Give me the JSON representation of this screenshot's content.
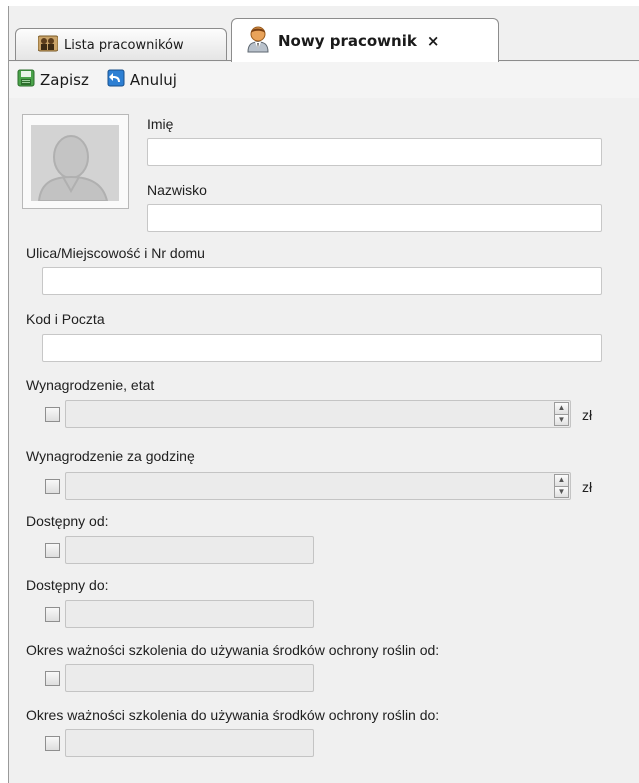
{
  "tabs": {
    "inactive_label": "Lista pracowników",
    "active_label": "Nowy pracownik",
    "close_glyph": "×"
  },
  "toolbar": {
    "save_label": "Zapisz",
    "cancel_label": "Anuluj"
  },
  "form": {
    "first_name_label": "Imię",
    "first_name_value": "",
    "last_name_label": "Nazwisko",
    "last_name_value": "",
    "street_label": "Ulica/Miejscowość i Nr domu",
    "street_value": "",
    "postal_label": "Kod i Poczta",
    "postal_value": "",
    "salary_label": "Wynagrodzenie, etat",
    "salary_value": "",
    "salary_unit": "zł",
    "hourly_label": "Wynagrodzenie za godzinę",
    "hourly_value": "",
    "hourly_unit": "zł",
    "available_from_label": "Dostępny od:",
    "available_from_value": "",
    "available_to_label": "Dostępny do:",
    "available_to_value": "",
    "training_from_label": "Okres ważności szkolenia do używania środków ochrony roślin od:",
    "training_from_value": "",
    "training_to_label": "Okres ważności szkolenia do używania środków ochrony roślin do:",
    "training_to_value": ""
  },
  "icons": {
    "employees_tab": "employees-group-icon",
    "new_employee_tab": "person-icon",
    "save": "save-disk-icon",
    "cancel": "undo-arrow-icon",
    "photo": "avatar-placeholder-icon"
  },
  "colors": {
    "save_icon": "#3a8f3a",
    "cancel_icon": "#1f6fc4",
    "person_icon": "#e08a2c"
  }
}
